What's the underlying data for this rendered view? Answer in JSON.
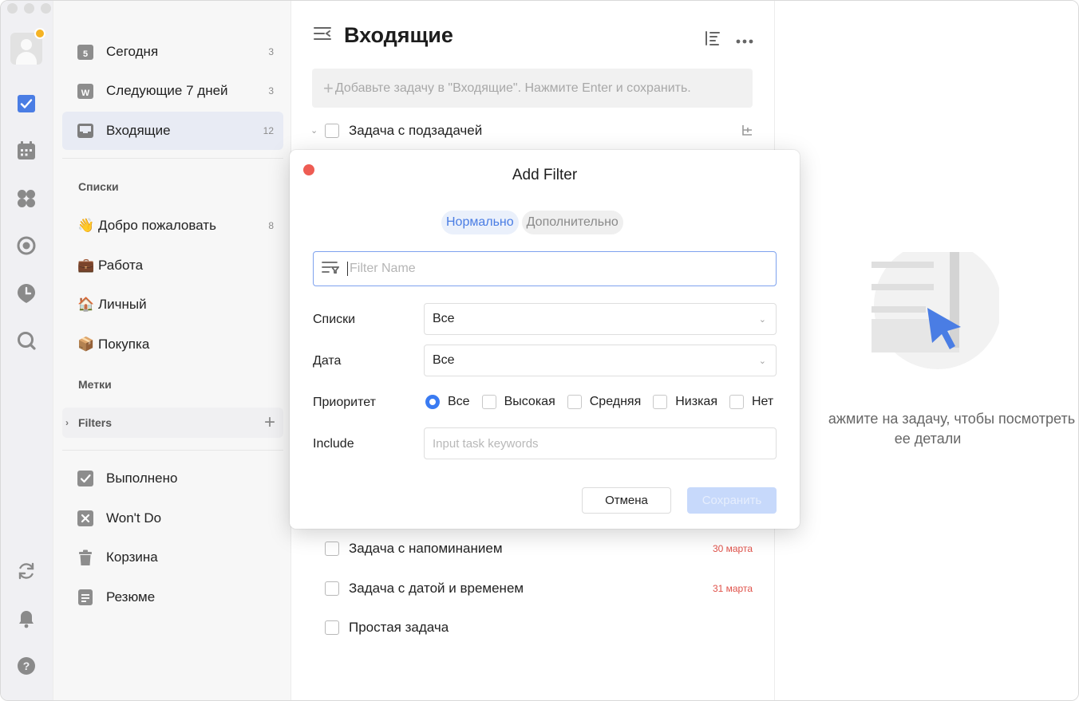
{
  "window": {
    "traffic_lights": [
      "close",
      "minimize",
      "zoom"
    ]
  },
  "rail": {
    "items": [
      {
        "icon": "avatar-icon"
      },
      {
        "icon": "task-checkbox-icon",
        "active": true
      },
      {
        "icon": "calendar-icon"
      },
      {
        "icon": "matrix-icon"
      },
      {
        "icon": "pomodoro-icon"
      },
      {
        "icon": "habit-icon"
      },
      {
        "icon": "search-icon"
      },
      {
        "icon": "sync-icon"
      },
      {
        "icon": "notification-bell-icon"
      },
      {
        "icon": "help-icon"
      }
    ]
  },
  "sidebar": {
    "smart_lists": [
      {
        "label": "Сегодня",
        "count": "3",
        "icon": "calendar-day-icon",
        "icon_text": "5"
      },
      {
        "label": "Следующие 7 дней",
        "count": "3",
        "icon": "calendar-week-icon",
        "icon_text": "W"
      },
      {
        "label": "Входящие",
        "count": "12",
        "icon": "inbox-icon",
        "active": true
      }
    ],
    "lists_section": "Списки",
    "lists": [
      {
        "emoji": "👋",
        "label": "Добро пожаловать",
        "count": "8"
      },
      {
        "emoji": "💼",
        "label": "Работа",
        "count": ""
      },
      {
        "emoji": "🏠",
        "label": "Личный",
        "count": ""
      },
      {
        "emoji": "📦",
        "label": "Покупка",
        "count": ""
      }
    ],
    "tags_section": "Метки",
    "filters_section": "Filters",
    "bottom": [
      {
        "label": "Выполнено",
        "icon": "completed-icon"
      },
      {
        "label": "Won't Do",
        "icon": "wont-do-icon"
      },
      {
        "label": "Корзина",
        "icon": "trash-icon"
      },
      {
        "label": "Резюме",
        "icon": "summary-icon"
      }
    ]
  },
  "main": {
    "title": "Входящие",
    "add_task_placeholder": "Добавьте задачу в \"Входящие\". Нажмите Enter и сохранить.",
    "tasks_top": [
      {
        "label": "Задача с подзадачей",
        "date": ""
      }
    ],
    "tasks_bottom": [
      {
        "label": "Задача с напоминанием",
        "date": "30 марта"
      },
      {
        "label": "Задача с датой и временем",
        "date": "31 марта"
      },
      {
        "label": "Простая задача",
        "date": ""
      }
    ]
  },
  "detail": {
    "empty_line1": "ажмите на задачу, чтобы посмотреть",
    "empty_line2": "ее детали"
  },
  "modal": {
    "title": "Add Filter",
    "tab_normal": "Нормально",
    "tab_advanced": "Дополнительно",
    "name_placeholder": "Filter Name",
    "lists_label": "Списки",
    "lists_value": "Все",
    "date_label": "Дата",
    "date_value": "Все",
    "priority_label": "Приоритет",
    "priority_options": [
      {
        "label": "Все",
        "selected": true
      },
      {
        "label": "Высокая",
        "selected": false
      },
      {
        "label": "Средняя",
        "selected": false
      },
      {
        "label": "Низкая",
        "selected": false
      },
      {
        "label": "Нет",
        "selected": false
      }
    ],
    "include_label": "Include",
    "include_placeholder": "Input task keywords",
    "cancel_label": "Отмена",
    "save_label": "Сохранить"
  },
  "colors": {
    "accent": "#4a7de4",
    "danger_date": "#e0524a",
    "close_dot": "#ee5c53",
    "crown": "#f5b324"
  }
}
